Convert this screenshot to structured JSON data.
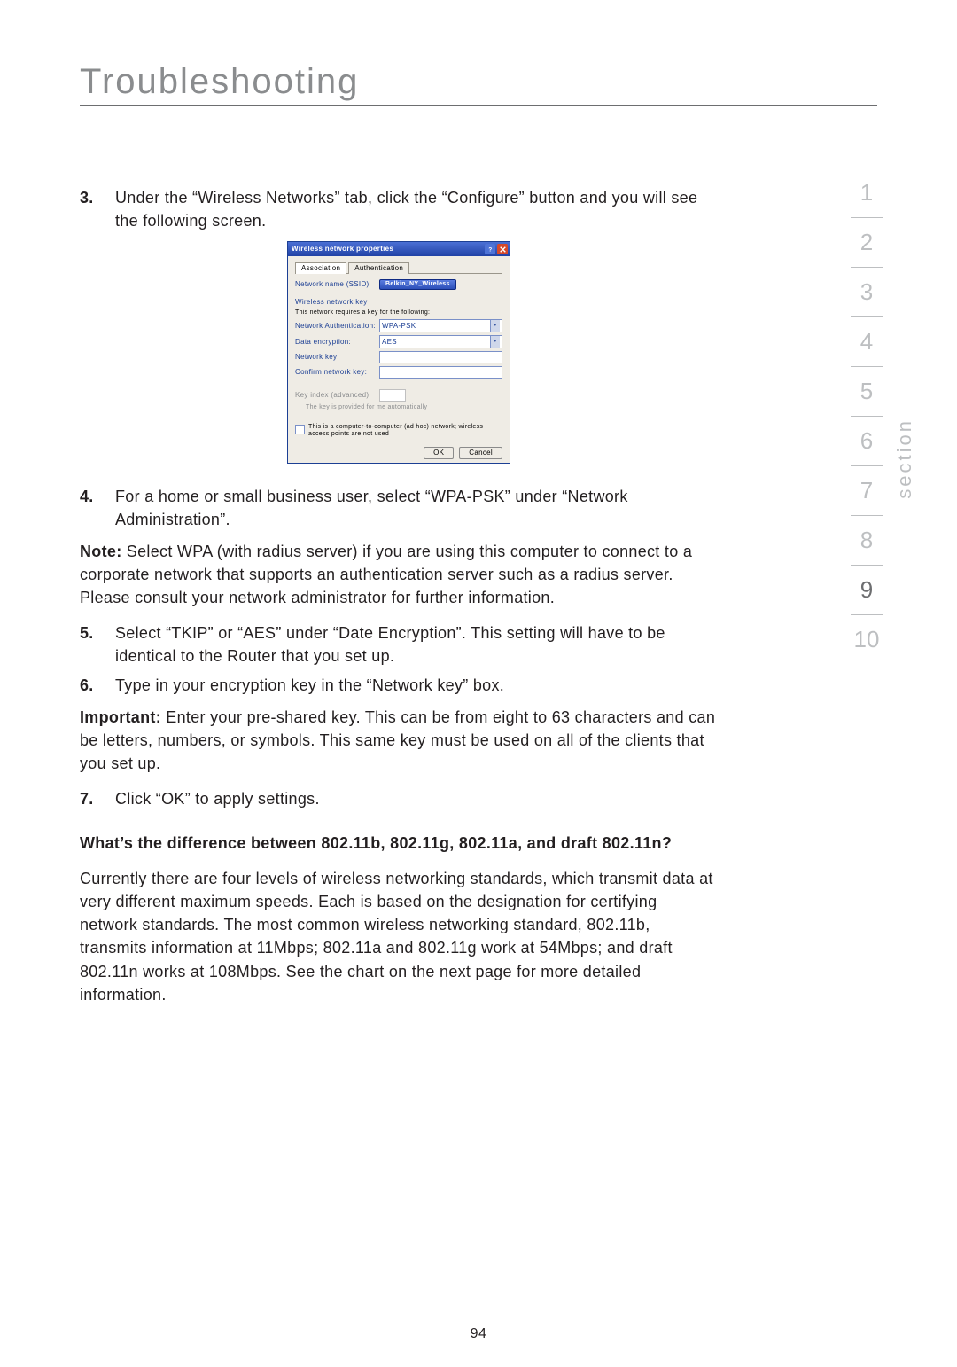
{
  "title": "Troubleshooting",
  "page_number": "94",
  "nav": {
    "label": "section",
    "items": [
      "1",
      "2",
      "3",
      "4",
      "5",
      "6",
      "7",
      "8",
      "9",
      "10"
    ],
    "active_index": 8
  },
  "steps": {
    "s3_num": "3.",
    "s3_txt": "Under the “Wireless Networks” tab, click the “Configure” button and you will see the following screen.",
    "s4_num": "4.",
    "s4_txt": "For a home or small business user, select “WPA-PSK” under “Network Administration”.",
    "s5_num": "5.",
    "s5_txt": "Select “TKIP” or “AES” under “Date Encryption”. This setting will have to be identical to the Router that you set up.",
    "s6_num": "6.",
    "s6_txt": "Type in your encryption key in the “Network key” box.",
    "s7_num": "7.",
    "s7_txt": "Click “OK” to apply settings."
  },
  "note_label": "Note:",
  "note_txt": " Select WPA (with radius server) if you are using this computer to connect to a corporate network that supports an authentication server such as a radius server. Please consult your network administrator for further information.",
  "important_label": "Important:",
  "important_txt": " Enter your pre-shared key. This can be from eight to 63 characters and can be letters, numbers, or symbols. This same key must be used on all of the clients that you set up.",
  "subheading": "What’s the difference between 802.11b, 802.11g, 802.11a, and draft 802.11n?",
  "answer": "Currently there are four levels of wireless networking standards, which transmit data at very different maximum speeds. Each is based on the designation for certifying network standards. The most common wireless networking standard, 802.11b, transmits information at 11Mbps; 802.11a and 802.11g work at 54Mbps; and draft 802.11n works at 108Mbps. See the chart on the next page for more detailed information.",
  "dialog": {
    "title": "Wireless network properties",
    "tabs": [
      "Association",
      "Authentication"
    ],
    "ssid_label": "Network name (SSID):",
    "ssid_button": "Belkin_NY_Wireless",
    "section_label": "Wireless network key",
    "section_hint": "This network requires a key for the following:",
    "auth_label": "Network Authentication:",
    "auth_value": "WPA-PSK",
    "enc_label": "Data encryption:",
    "enc_value": "AES",
    "key_label": "Network key:",
    "confirm_label": "Confirm network key:",
    "index_label": "Key index (advanced):",
    "auto_text": "The key is provided for me automatically",
    "adhoc_text": "This is a computer-to-computer (ad hoc) network; wireless access points are not used",
    "ok": "OK",
    "cancel": "Cancel"
  }
}
